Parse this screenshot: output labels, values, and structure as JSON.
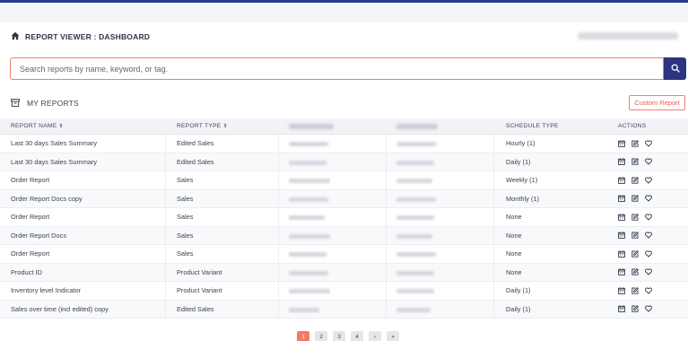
{
  "header": {
    "title": "REPORT VIEWER : DASHBOARD"
  },
  "search": {
    "placeholder": "Search reports by name, keyword, or tag."
  },
  "section": {
    "title": "MY REPORTS",
    "custom_report_label": "Custom Report"
  },
  "table": {
    "columns": {
      "report_name": "REPORT NAME",
      "report_type": "REPORT TYPE",
      "schedule_type": "SCHEDULE TYPE",
      "actions": "ACTIONS"
    },
    "rows": [
      {
        "name": "Last 30 days Sales Summary",
        "type": "Edited Sales",
        "schedule": "Hourly (1)"
      },
      {
        "name": "Last 30 days Sales Summary",
        "type": "Edited Sales",
        "schedule": "Daily (1)"
      },
      {
        "name": "Order Report",
        "type": "Sales",
        "schedule": "Weekly (1)"
      },
      {
        "name": "Order Report Docs copy",
        "type": "Sales",
        "schedule": "Monthly (1)"
      },
      {
        "name": "Order Report",
        "type": "Sales",
        "schedule": "None"
      },
      {
        "name": "Order Report Docs",
        "type": "Sales",
        "schedule": "None"
      },
      {
        "name": "Order Report",
        "type": "Sales",
        "schedule": "None"
      },
      {
        "name": "Product ID",
        "type": "Product Variant",
        "schedule": "None"
      },
      {
        "name": "Inventory level Indicator",
        "type": "Product Variant",
        "schedule": "Daily (1)"
      },
      {
        "name": "Sales over time (incl edited) copy",
        "type": "Edited Sales",
        "schedule": "Daily (1)"
      }
    ]
  },
  "pagination": {
    "pages": [
      "1",
      "2",
      "3",
      "4"
    ],
    "next": "›",
    "last": "»",
    "current": "1"
  },
  "icons": {
    "home": "home-icon",
    "search": "search-icon",
    "reports": "archive-icon",
    "schedule": "calendar-icon",
    "edit": "edit-icon",
    "favorite": "heart-icon"
  },
  "colors": {
    "accent": "#f08070",
    "primary": "#2d3580",
    "active_page": "#f47b67"
  }
}
